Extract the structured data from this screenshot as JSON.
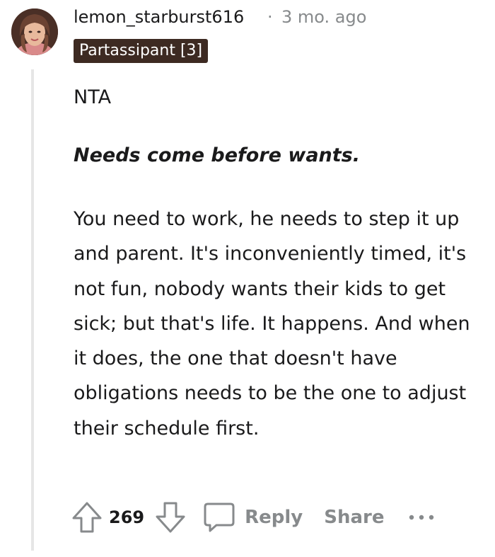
{
  "comment": {
    "username": "lemon_starburst616",
    "separator": "·",
    "timestamp": "3 mo. ago",
    "flair": "Partassipant [3]",
    "paragraphs": {
      "first": "NTA",
      "bold": "Needs come before wants.",
      "main": "You need to work, he needs to step it up and parent. It's inconveniently timed, it's not fun, nobody wants their kids to get sick; but that's life. It happens. And when it does, the one that doesn't have obligations needs to be the one to adjust their schedule first."
    }
  },
  "actions": {
    "vote_count": "269",
    "reply_label": "Reply",
    "share_label": "Share",
    "icons": {
      "upvote": "arrow-up-outline",
      "downvote": "arrow-down-outline",
      "reply": "speech-bubble",
      "more": "three-dots"
    }
  },
  "colors": {
    "text": "#1a1a1b",
    "muted": "#878a8c",
    "flair_bg": "#3d2a22",
    "thread_line": "#e6e6e6"
  }
}
